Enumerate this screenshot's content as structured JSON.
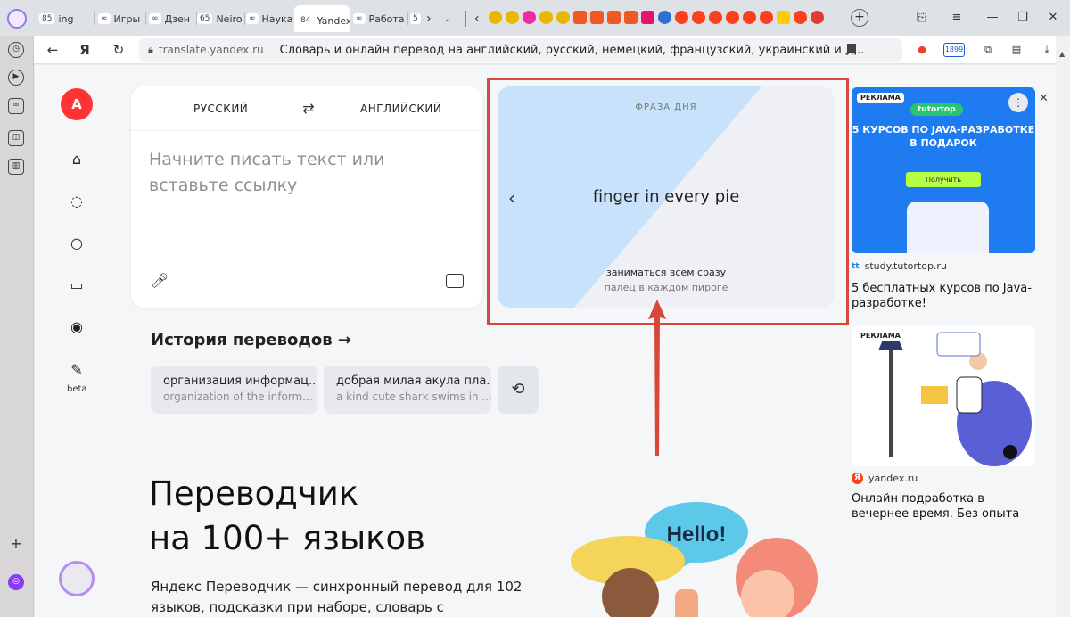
{
  "tabs": [
    {
      "count": "85",
      "label": "ing"
    },
    {
      "count": "∞",
      "label": "Игры"
    },
    {
      "count": "∞",
      "label": "Дзен"
    },
    {
      "count": "65",
      "label": "Neiro"
    },
    {
      "count": "∞",
      "label": "Наука"
    },
    {
      "count": "84",
      "label": "Yandex"
    },
    {
      "count": "∞",
      "label": "Работа"
    },
    {
      "count": "5",
      "label": ""
    }
  ],
  "address_bar": {
    "domain": "translate.yandex.ru",
    "title": "Словарь и онлайн перевод на английский, русский, немецкий, французский, украинский и д..."
  },
  "extensions": {
    "badge": "1899"
  },
  "translator": {
    "source_lang": "РУССКИЙ",
    "target_lang": "АНГЛИЙСКИЙ",
    "input_placeholder": "Начните писать текст или вставьте ссылку",
    "beta_label": "beta"
  },
  "phrase_of_day": {
    "label": "ФРАЗА ДНЯ",
    "phrase": "finger in every pie",
    "translation": "заниматься всем сразу",
    "literal": "палец в каждом пироге"
  },
  "history": {
    "title": "История переводов →",
    "items": [
      {
        "source": "организация информац...",
        "translation": "organization of the inform..."
      },
      {
        "source": "добрая милая акула пла...",
        "translation": "a kind cute shark swims in ..."
      }
    ]
  },
  "promo": {
    "title_line1": "Переводчик",
    "title_line2": "на 100+ языков",
    "description": "Яндекс Переводчик — синхронный перевод для 102 языков, подсказки при наборе, словарь с транскрипцией,",
    "bubble_text": "Hello!"
  },
  "ads": [
    {
      "badge": "РЕКЛАМА",
      "brand": "tutortop",
      "headline": "5 КУРСОВ ПО JAVA-РАЗРАБОТКЕ В ПОДАРОК",
      "button": "Получить",
      "source_mark": "tt",
      "source": "study.tutortop.ru",
      "text": "5 бесплатных курсов по Java-разработке!"
    },
    {
      "badge": "РЕКЛАМА",
      "source_mark": "Я",
      "source": "yandex.ru",
      "text": "Онлайн подработка в вечернее время. Без опыта"
    }
  ],
  "colors": {
    "accent_red": "#d9463b",
    "phrase_blue": "#c7e2fa",
    "ad_blue": "#1e7cf0"
  }
}
